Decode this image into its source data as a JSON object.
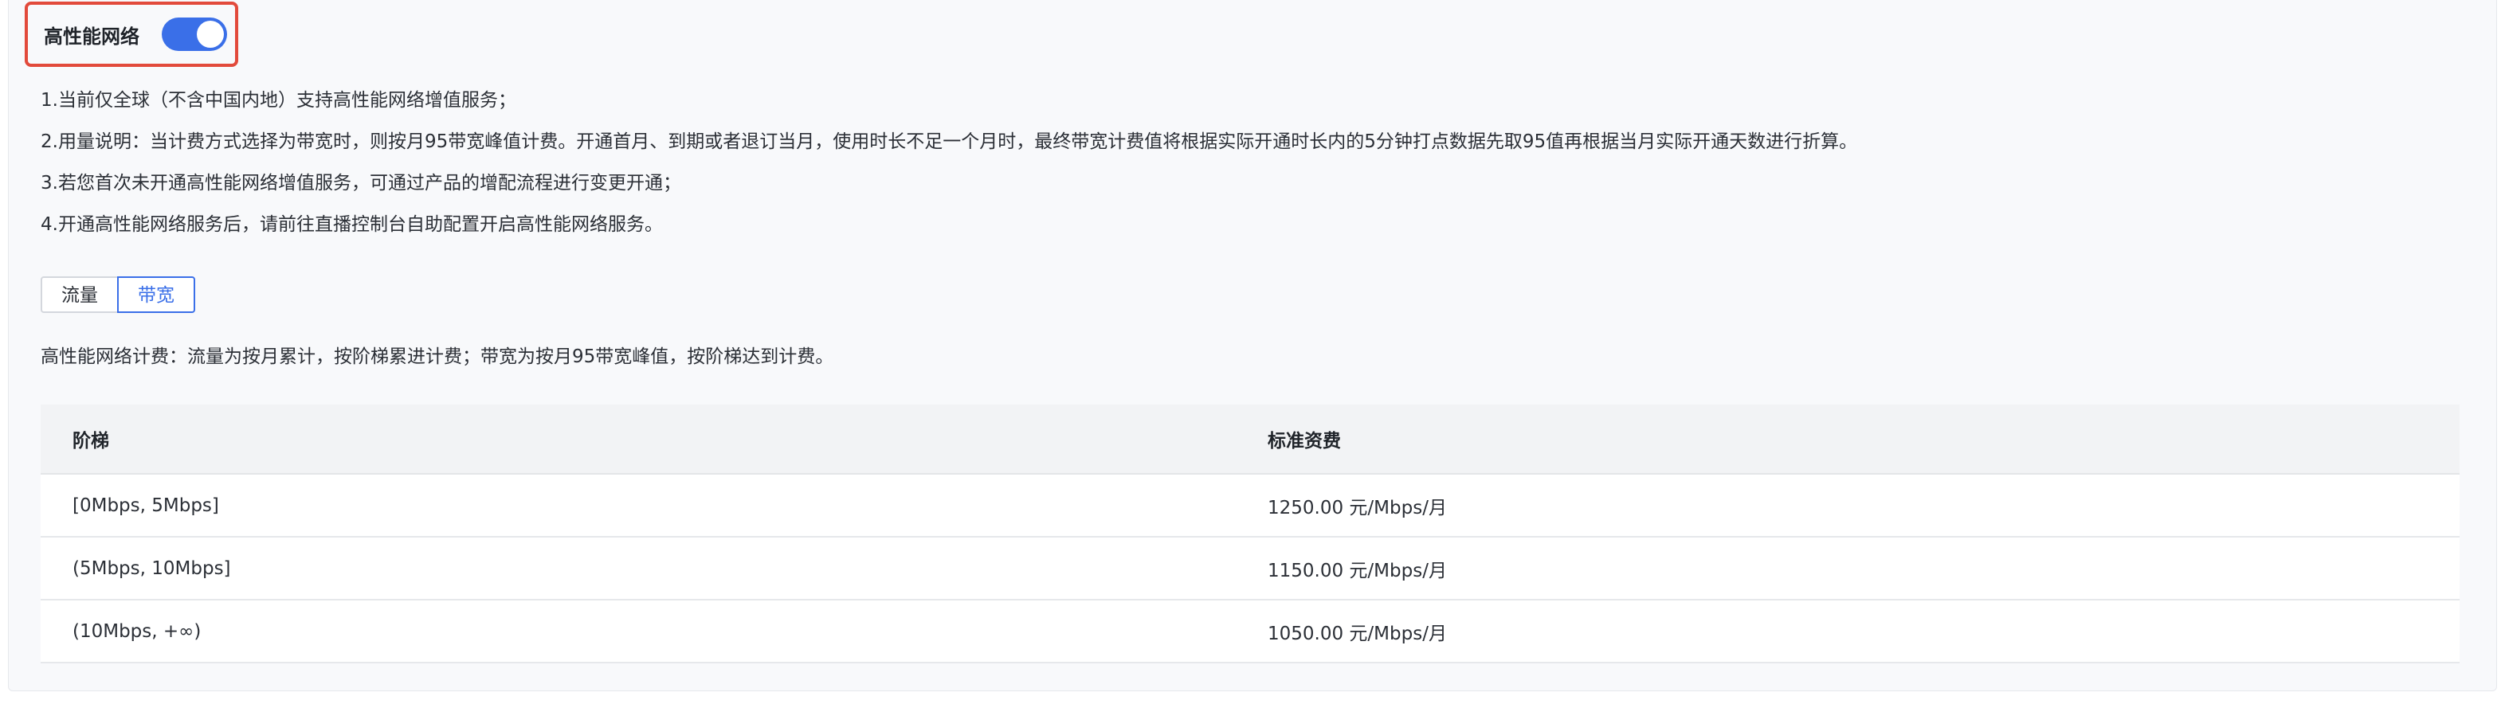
{
  "toggle": {
    "label": "高性能网络",
    "on": true
  },
  "notes": [
    "1.当前仅全球（不含中国内地）支持高性能网络增值服务；",
    "2.用量说明：当计费方式选择为带宽时，则按月95带宽峰值计费。开通首月、到期或者退订当月，使用时长不足一个月时，最终带宽计费值将根据实际开通时长内的5分钟打点数据先取95值再根据当月实际开通天数进行折算。",
    "3.若您首次未开通高性能网络增值服务，可通过产品的增配流程进行变更开通；",
    "4.开通高性能网络服务后，请前往直播控制台自助配置开启高性能网络服务。"
  ],
  "segments": {
    "traffic": "流量",
    "bandwidth": "带宽",
    "selected": "带宽"
  },
  "billing_note": "高性能网络计费：流量为按月累计，按阶梯累进计费；带宽为按月95带宽峰值，按阶梯达到计费。",
  "table": {
    "headers": [
      "阶梯",
      "标准资费"
    ],
    "rows": [
      [
        "[0Mbps, 5Mbps]",
        "1250.00 元/Mbps/月"
      ],
      [
        "(5Mbps, 10Mbps]",
        "1150.00 元/Mbps/月"
      ],
      [
        "(10Mbps, +∞)",
        "1050.00 元/Mbps/月"
      ]
    ]
  },
  "colors": {
    "accent": "#3a6fe8",
    "highlight_border": "#e24a3b"
  }
}
